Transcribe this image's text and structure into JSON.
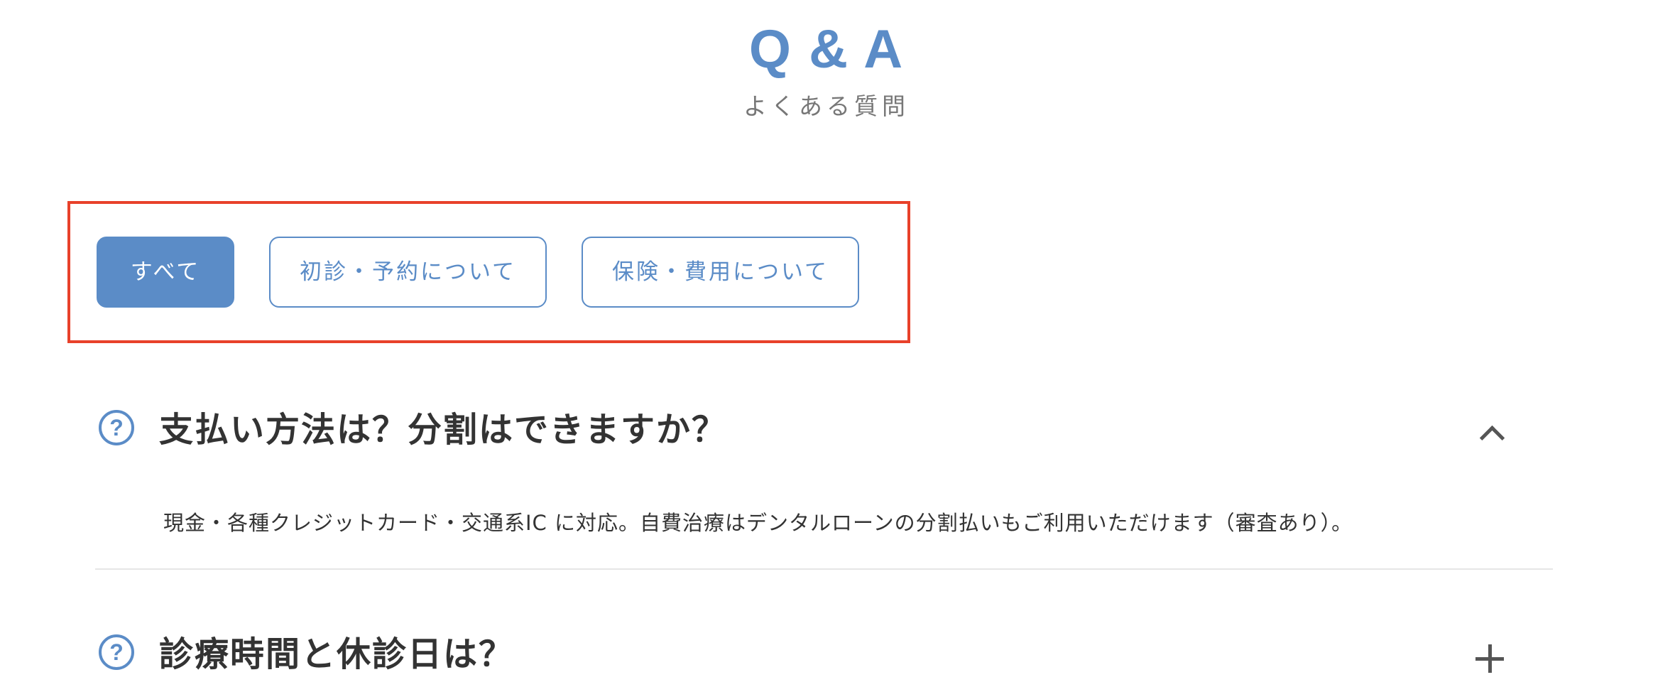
{
  "header": {
    "title": "Q & A",
    "subtitle": "よくある質問"
  },
  "filters": [
    {
      "label": "すべて",
      "active": true
    },
    {
      "label": "初診・予約について",
      "active": false
    },
    {
      "label": "保険・費用について",
      "active": false
    }
  ],
  "faq": [
    {
      "question": "支払い方法は？分割はできますか？",
      "answer": "現金・各種クレジットカード・交通系IC に対応。自費治療はデンタルローンの分割払いもご利用いただけます（審査あり）。",
      "expanded": true
    },
    {
      "question": "診療時間と休診日は？",
      "expanded": false
    }
  ],
  "icons": {
    "question": "?",
    "expanded_toggle": "chevron-up-icon",
    "collapsed_toggle": "plus-icon"
  },
  "colors": {
    "accent": "#5b8cc7",
    "highlight_border": "#e8412a",
    "text": "#333333",
    "subtext": "#777777",
    "divider": "#e6e6e6"
  }
}
